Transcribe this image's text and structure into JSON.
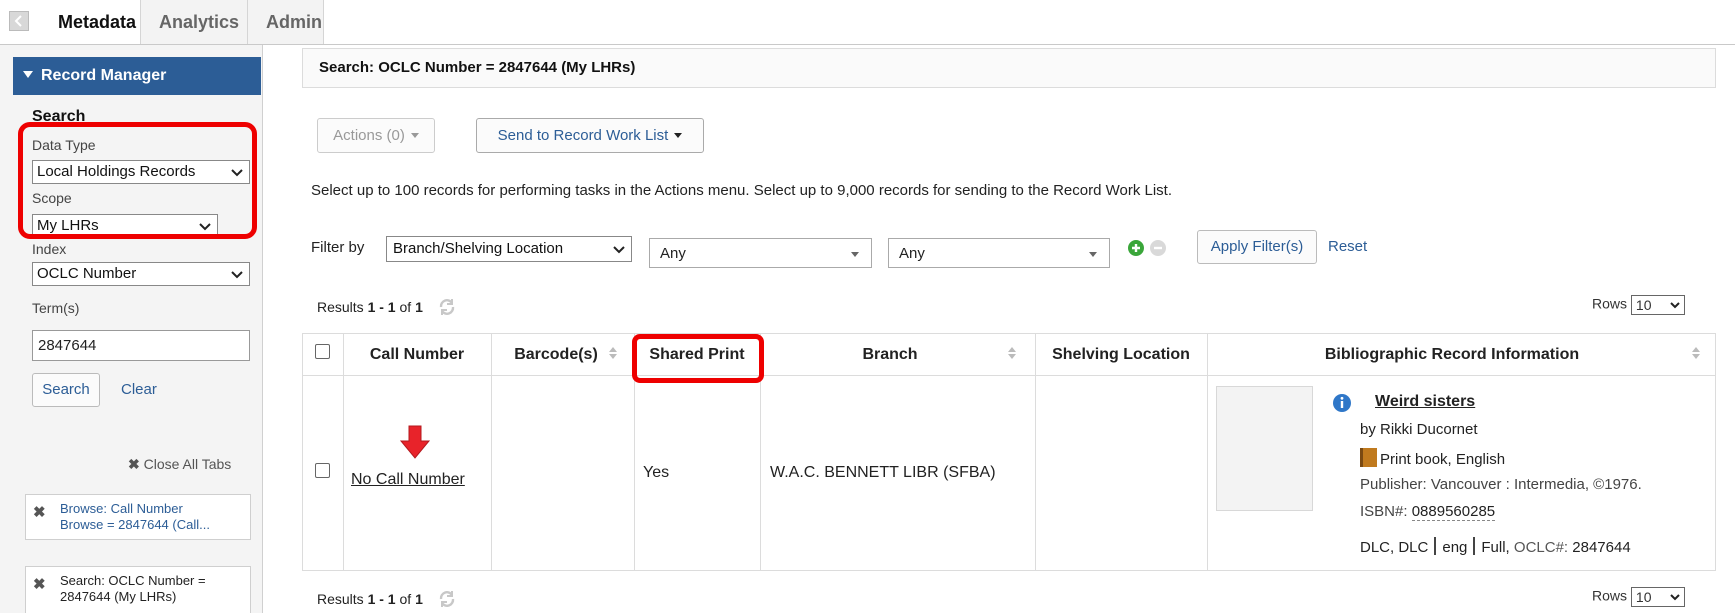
{
  "tabs": [
    {
      "label": "Metadata"
    },
    {
      "label": "Analytics"
    },
    {
      "label": "Admin"
    }
  ],
  "sidebar": {
    "header": "Record Manager",
    "search_title": "Search",
    "data_type_label": "Data Type",
    "data_type_value": "Local Holdings Records",
    "scope_label": "Scope",
    "scope_value": "My LHRs",
    "index_label": "Index",
    "index_value": "OCLC Number",
    "terms_label": "Term(s)",
    "terms_value": "2847644",
    "search_button": "Search",
    "clear_link": "Clear",
    "close_all_tabs": "Close All Tabs",
    "history": [
      {
        "line1": "Browse: Call Number",
        "line2": "Browse = 2847644 (Call..."
      },
      {
        "line1": "Search: OCLC Number =",
        "line2": "2847644 (My LHRs)"
      }
    ]
  },
  "main": {
    "search_header": "Search: OCLC Number = 2847644 (My LHRs)",
    "actions_button": "Actions (0)",
    "send_button": "Send to Record Work List",
    "instruction": "Select up to 100 records for performing tasks in the Actions menu.  Select up to 9,000 records for sending to the Record Work List.",
    "filter_label": "Filter by",
    "filter_field": "Branch/Shelving Location",
    "filter_value_1": "Any",
    "filter_value_2": "Any",
    "apply_filters": "Apply Filter(s)",
    "reset": "Reset",
    "results_prefix": "Results",
    "results_range": "1 - 1",
    "results_of": "of",
    "results_total": "1",
    "rows_label": "Rows",
    "rows_value": "10"
  },
  "table": {
    "columns": [
      "Call Number",
      "Barcode(s)",
      "Shared Print",
      "Branch",
      "Shelving Location",
      "Bibliographic Record Information"
    ],
    "row": {
      "call_number": "No Call Number",
      "barcodes": "",
      "shared_print": "Yes",
      "branch": "W.A.C. BENNETT LIBR (SFBA)",
      "shelving_location": "",
      "bib": {
        "title": "Weird sisters",
        "author": "by Rikki Ducornet",
        "format": "Print book, English",
        "publisher": "Publisher: Vancouver : Intermedia, ©1976.",
        "isbn_label": "ISBN#:",
        "isbn": "0889560285",
        "source": "DLC, DLC",
        "lang": "eng",
        "level": "Full,",
        "oclc_label": "OCLC#:",
        "oclc": "2847644"
      }
    }
  },
  "colors": {
    "header_blue": "#2c5d96",
    "highlight_red": "#ee0000",
    "add_green": "#3aa63a"
  }
}
